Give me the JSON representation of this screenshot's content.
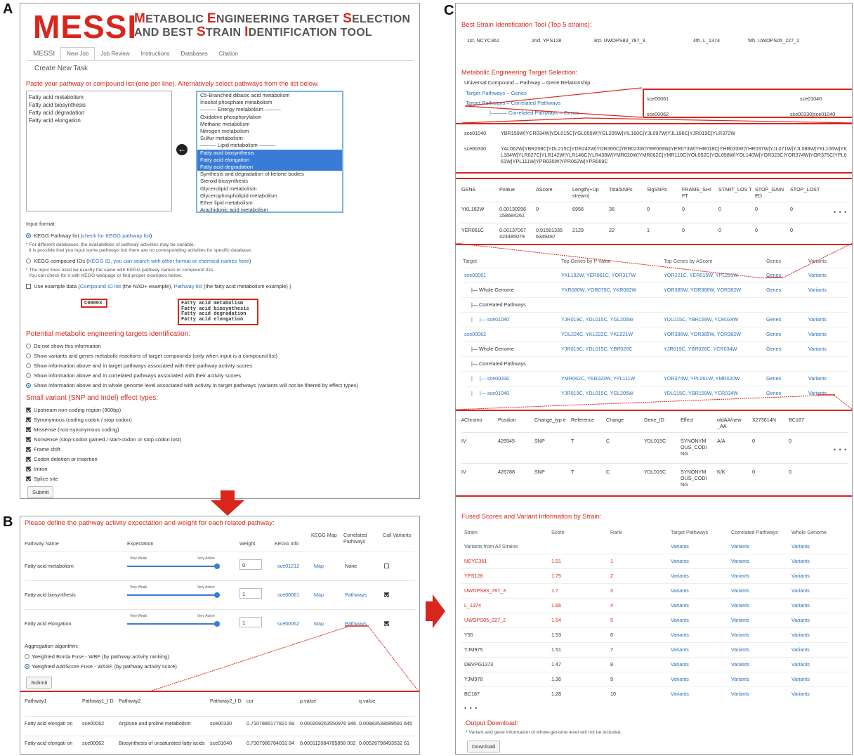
{
  "labels": {
    "a": "A",
    "b": "B",
    "c": "C"
  },
  "a": {
    "logo": "MESSI",
    "subtitle_l1": [
      "M",
      "ETABOLIC ",
      "E",
      "NGINEERING TARGET ",
      "S",
      "ELECTION"
    ],
    "subtitle_l2": [
      "AND BEST ",
      "S",
      "TRAIN ",
      "I",
      "DENTIFICATION TOOL"
    ],
    "nav": [
      "MESSI",
      "New Job",
      "Job Review",
      "Instructions",
      "Databases",
      "Citation"
    ],
    "task_title": "Create New Task",
    "paste_prompt": "Paste your pathway or compound list (one per line). Alternatively select pathways from the list below.",
    "textarea_lines": [
      "Fatty acid metabolism",
      "Fatty acid biosynthesis",
      "Fatty acid degradation",
      "Fatty acid elongation"
    ],
    "list_items": [
      {
        "t": "C5-Branched dibasic acid metabolism",
        "s": false
      },
      {
        "t": "Inositol phosphate metabolism",
        "s": false
      },
      {
        "t": "——— Energy metabolism ———",
        "s": false
      },
      {
        "t": "Oxidative phosphorylation",
        "s": false
      },
      {
        "t": "Methane metabolism",
        "s": false
      },
      {
        "t": "Nitrogen metabolism",
        "s": false
      },
      {
        "t": "Sulfur metabolism",
        "s": false
      },
      {
        "t": "——— Lipid metabolism ———",
        "s": false
      },
      {
        "t": "Fatty acid biosynthesis",
        "s": true
      },
      {
        "t": "Fatty acid elongation",
        "s": true
      },
      {
        "t": "Fatty acid degradation",
        "s": true
      },
      {
        "t": "Synthesis and degradation of ketone bodies",
        "s": false
      },
      {
        "t": "Steroid biosynthesis",
        "s": false
      },
      {
        "t": "Glycerolipid metabolism",
        "s": false
      },
      {
        "t": "Glycerophospholipid metabolism",
        "s": false
      },
      {
        "t": "Ether lipid metabolism",
        "s": false
      },
      {
        "t": "Arachidonic acid metabolism",
        "s": false
      }
    ],
    "input_format": "Input format:",
    "kegg_pw": "KEGG Pathway list (",
    "kegg_pw_link": "check for KEGG pathway list",
    "kegg_pw_end": ")",
    "note1a": "* For different databases, the availabilities of pathway activities may be variable.",
    "note1b": "  It is possible that you input some pathways but there are no corresponding activities for spesific database.",
    "kegg_cp": "KEGG compound IDs (",
    "kegg_cp_link": "KEGG ID, you can search with other format or chemical names here",
    "kegg_cp_end": ")",
    "note2a": "* The input lines must be exactly the same with KEGG pathway names or compound IDs.",
    "note2b": "  You can check for it with KEGG webpage or find proper examples below.",
    "ex_a": "Use example data (",
    "ex_link1": "Compound ID list",
    "ex_b": " (the NAD+ example), ",
    "ex_link2": "Pathway list",
    "ex_c": " (the fatty acid metabolism example) )",
    "compound_ex": "C00003",
    "pathway_ex": [
      "Fatty acid metabolism",
      "Fatty acid biosynthesis",
      "Fatty acid degradation",
      "Fatty acid elongation"
    ],
    "targets_title": "Potential metabolic engineering targets identification:",
    "target_opts": [
      {
        "t": "Do not show this information",
        "on": false
      },
      {
        "t": "Show variants and genes metabolic reactions of target compounds (only when input is a compound list)",
        "on": false
      },
      {
        "t": "Show information above and in target pathways associated with their pathway activity scores",
        "on": false
      },
      {
        "t": "Show information above and in correlated pathways associated with their activity scores",
        "on": false
      },
      {
        "t": "Show information above and in whole genome level associated with activity in target pathways (variants will not be filtered by effect types)",
        "on": true
      }
    ],
    "variant_title": "Small variant (SNP and Indel) effect types:",
    "variant_opts": [
      "Upstream non-coding region (800bp)",
      "Synonymous (coding codon / stop codon)",
      "Missense (non-synonymous coding)",
      "Nonsense (stop-codon gained / start-codon or stop codon lost)",
      "Frame shift",
      "Codon deletion or insertion",
      "Intron",
      "Splice site"
    ],
    "submit": "Submit"
  },
  "b": {
    "title": "Please define the pathway activity expectation and weight for each related pathway:",
    "headers": [
      "Pathway Name",
      "Expectation",
      "Weight",
      "KEGG Info",
      "KEGG Map",
      "Correlated Pathways",
      "Call Variants"
    ],
    "slider_weak": "Very Weak",
    "slider_active": "Very Active",
    "rows": [
      {
        "name": "Fatty acid metabolism",
        "weight": "0",
        "kegg": "sce01212",
        "map": "Map",
        "corr": "None",
        "call": false
      },
      {
        "name": "Fatty acid biosynthesis",
        "weight": "1",
        "kegg": "sce00061",
        "map": "Map",
        "corr": "Pathways",
        "call": true
      },
      {
        "name": "Fatty acid elongation",
        "weight": "1",
        "kegg": "sce00062",
        "map": "Map",
        "corr": "Pathways",
        "call": true
      }
    ],
    "agg_title": "Aggregation algorithm:",
    "agg_opts": [
      {
        "t": "Weighted Borda Fuse - WBF (by pathway activity ranking)",
        "on": false
      },
      {
        "t": "Weighted AddScore Fuse - WASF (by pathway activity score)",
        "on": true
      }
    ],
    "submit": "Submit",
    "corr_headers": [
      "Pathway1",
      "Pathway1_I D",
      "Pathway2",
      "Pathway2_I D",
      "cor",
      "p.value",
      "q.value"
    ],
    "corr_rows": [
      [
        "Fatty acid elongati on",
        "sce00062",
        "Arginine and proline metabolism",
        "sce00330",
        "0.7107886177821 68",
        "0.000209263550976 946",
        "0.00983538689591 645"
      ],
      [
        "Fatty acid elongati on",
        "sce00062",
        "Biosynthesis of unsaturated fatty acids",
        "sce01040",
        "0.7307986784031 84",
        "0.000112084785858 002",
        "0.00526798493532 61"
      ]
    ]
  },
  "c": {
    "best_title": "Best Strain Identification Tool (Top 5 strains):",
    "best": [
      "1st. NCYC361",
      "2nd. YPS128",
      "3rd. UWOPS83_787_3",
      "4th. L_1374",
      "5th. UWOPS05_227_2"
    ],
    "met_title": "Metabolic Engineering Target Selection:",
    "met_sub": "Universal Compound – Pathway – Gene Relationship",
    "tree": [
      "Target Pathways – Genes",
      "Target Pathways – Correlated Pathways",
      "|——— Correlated Pathways – Genes"
    ],
    "pairs": [
      [
        "sce00061",
        "sce01040"
      ],
      [
        "sce00062",
        "sce00330|sce01040"
      ]
    ],
    "genes": [
      {
        "id": "sce01040",
        "g": "YBR159W|YCR034W|YDL015C|YGL055W|YGL205W|YIL160C|YJL097W|YJL196C|YJR019C|YLR372W"
      },
      {
        "id": "sce00330",
        "g": "YAL062W|YBR208C|YDL215C|YDR242W|YOR300C|YER023W|YER069W|YER073W|YHR018C|YHR033W|YHR037W|YJL071W|YJL088W|YKL106W|YKL184W|YLR027C|YLR142W|YLR146C|YLR438W|YMR020W|YMR062C|YMR110C|YOL052C|YOL058W|YOL140W|YOR323C|YOR374W|YOR375C|YPL061W|YPL111W|YPR035W|YPR062W|YPR069C"
      }
    ],
    "gh": [
      "GENE",
      "Pvalue",
      "AScore",
      "Length(+Up stream)",
      "TotalSNPs",
      "SigSNPs",
      "FRAME_SHI FT",
      "START_LOS T",
      "STOP_GAIN ED",
      "STOP_LOST"
    ],
    "gr": [
      [
        "YKL182W",
        "0.00130296 158684261",
        "0",
        "6956",
        "36",
        "0",
        "0",
        "0",
        "0",
        "0"
      ],
      [
        "YER061C",
        "0.00137067 424485079",
        "0.91581335 6349487",
        "2129",
        "22",
        "1",
        "0",
        "0",
        "0",
        "0"
      ]
    ],
    "th": [
      "Target",
      "Top Genes by P-value",
      "Top Genes by AScore",
      "Genes",
      "Variants"
    ],
    "tr": [
      {
        "lbl": "sce00061",
        "ind": 0,
        "blue": true,
        "p": "YKL182W, YER061C, YOR317W",
        "a": "YOR221C, YER015W, YPL231W",
        "g": "Genes",
        "v": "Variants"
      },
      {
        "lbl": "|— Whole Genome",
        "ind": 1,
        "blue": false,
        "p": "YKR080W, YOR079C, YKR082W",
        "a": "YOR385W, YOR386W, YOR382W",
        "g": "Genes",
        "v": "Variants"
      },
      {
        "lbl": "|— Correlated Pathways",
        "ind": 1,
        "blue": false,
        "p": "",
        "a": "",
        "g": "",
        "v": ""
      },
      {
        "lbl": "|     |— sce01040",
        "ind": 1,
        "blue": true,
        "p": "YJR019C, YDL015C, YGL205W",
        "a": "YDL015C, YBR159W, YCR034W",
        "g": "Genes",
        "v": "Variants"
      },
      {
        "lbl": "sce00062",
        "ind": 0,
        "blue": true,
        "p": "YDL224C, YKL222C, YKL221W",
        "a": "YOR386W, YOR385W, YOR382W",
        "g": "Genes",
        "v": "Variants"
      },
      {
        "lbl": "|— Whole Genome",
        "ind": 1,
        "blue": false,
        "p": "YJR019C, YDL015C, YBR026C",
        "a": "YJR019C, YBR026C, YCR034W",
        "g": "Genes",
        "v": "Variants"
      },
      {
        "lbl": "|— Correlated Pathways",
        "ind": 1,
        "blue": false,
        "p": "",
        "a": "",
        "g": "",
        "v": ""
      },
      {
        "lbl": "|     |— sce00330",
        "ind": 1,
        "blue": true,
        "p": "YMR062C, YER023W, YPL111W",
        "a": "YOR374W, YPL061W, YMR020W",
        "g": "Genes",
        "v": "Variants"
      },
      {
        "lbl": "|     |— sce01040",
        "ind": 1,
        "blue": true,
        "p": "YJR019C, YDL015C, YGL205W",
        "a": "YDL015C, YBR159W, YCR034W",
        "g": "Genes",
        "v": "Variants"
      }
    ],
    "vh": [
      "#Chromo",
      "Position",
      "Change_typ e",
      "Reference",
      "Change",
      "Gene_ID",
      "Effect",
      "oldAA/new _AA",
      "X273614N",
      "BC187"
    ],
    "vr": [
      [
        "IV",
        "426545",
        "SNP",
        "T",
        "C",
        "YDL015C",
        "SYNONYM OUS_CODI NG",
        "A/A",
        "0",
        "0"
      ],
      [
        "IV",
        "426788",
        "SNP",
        "T",
        "C",
        "YDL015C",
        "SYNONYM OUS_CODI NG",
        "K/K",
        "0",
        "0"
      ]
    ],
    "fused_title": "Fused Scores and Variant Information by Strain:",
    "fh": [
      "Strain",
      "Score",
      "Rank",
      "Target Pathways",
      "Correlated Pathways",
      "Whole Genome"
    ],
    "all": "Variants from All Strains",
    "fr": [
      [
        "NCYC361",
        "1.91",
        "1",
        true
      ],
      [
        "YPS128",
        "1.75",
        "2",
        true
      ],
      [
        "UWOPS83_787_3",
        "1.7",
        "3",
        true
      ],
      [
        "L_1374",
        "1.66",
        "4",
        true
      ],
      [
        "UWOPS05_227_2",
        "1.54",
        "5",
        true
      ],
      [
        "Y55",
        "1.53",
        "6",
        false
      ],
      [
        "YJM975",
        "1.51",
        "7",
        false
      ],
      [
        "DBVPG1373",
        "1.47",
        "8",
        false
      ],
      [
        "YJM978",
        "1.36",
        "9",
        false
      ],
      [
        "BC187",
        "1.28",
        "10",
        false
      ]
    ],
    "variants": "Variants",
    "ellipsis": "• • •",
    "out_title": "Output Download:",
    "out_note": "* Variant and gene information of whole-genome level will not be included.",
    "download": "Download"
  }
}
